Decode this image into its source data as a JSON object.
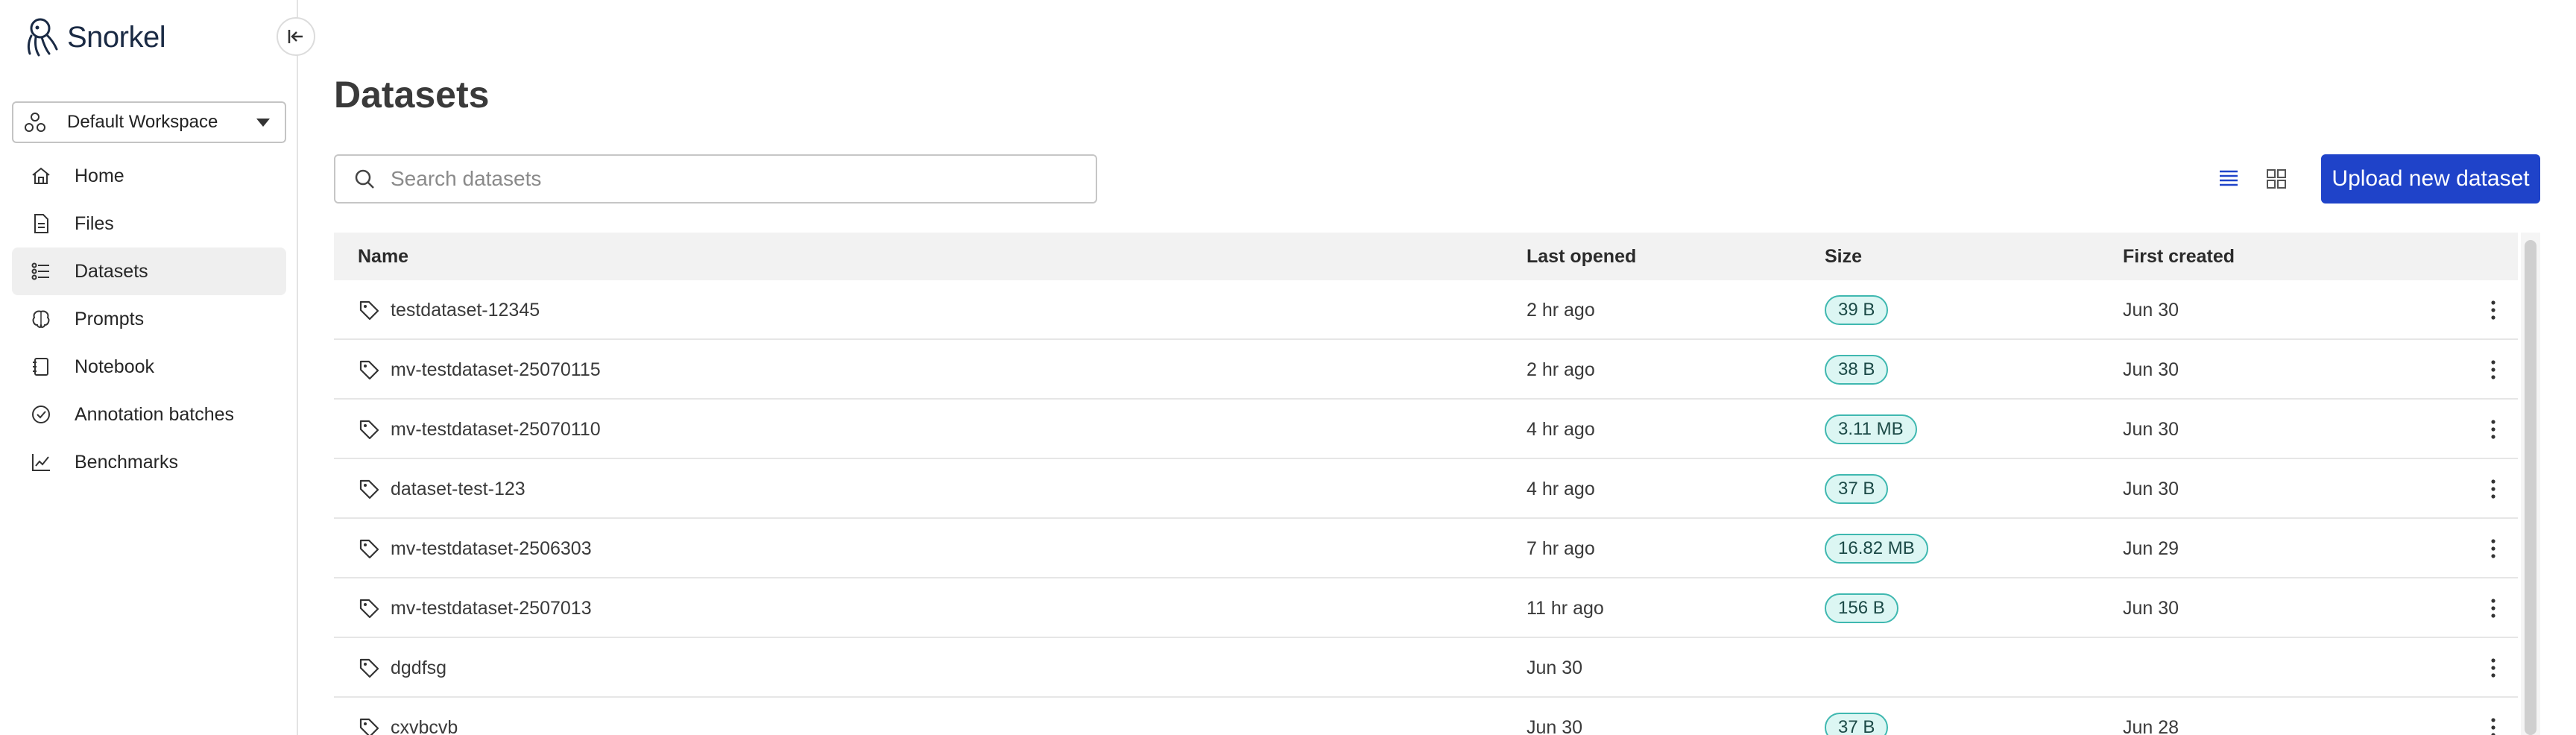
{
  "app": {
    "name": "Snorkel"
  },
  "sidebar": {
    "workspace": {
      "label": "Default Workspace"
    },
    "items": [
      {
        "label": "Home",
        "icon": "home-icon",
        "active": false
      },
      {
        "label": "Files",
        "icon": "file-icon",
        "active": false
      },
      {
        "label": "Datasets",
        "icon": "datasets-icon",
        "active": true
      },
      {
        "label": "Prompts",
        "icon": "brain-icon",
        "active": false
      },
      {
        "label": "Notebook",
        "icon": "notebook-icon",
        "active": false
      },
      {
        "label": "Annotation batches",
        "icon": "check-circle-icon",
        "active": false
      },
      {
        "label": "Benchmarks",
        "icon": "chart-icon",
        "active": false
      }
    ]
  },
  "main": {
    "title": "Datasets",
    "search": {
      "placeholder": "Search datasets",
      "value": ""
    },
    "upload_label": "Upload new dataset",
    "table": {
      "headers": {
        "name": "Name",
        "last_opened": "Last opened",
        "size": "Size",
        "first_created": "First created"
      },
      "rows": [
        {
          "name": "testdataset-12345",
          "last_opened": "2 hr ago",
          "size": "39 B",
          "first_created": "Jun 30"
        },
        {
          "name": "mv-testdataset-25070115",
          "last_opened": "2 hr ago",
          "size": "38 B",
          "first_created": "Jun 30"
        },
        {
          "name": "mv-testdataset-25070110",
          "last_opened": "4 hr ago",
          "size": "3.11 MB",
          "first_created": "Jun 30"
        },
        {
          "name": "dataset-test-123",
          "last_opened": "4 hr ago",
          "size": "37 B",
          "first_created": "Jun 30"
        },
        {
          "name": "mv-testdataset-2506303",
          "last_opened": "7 hr ago",
          "size": "16.82 MB",
          "first_created": "Jun 29"
        },
        {
          "name": "mv-testdataset-2507013",
          "last_opened": "11 hr ago",
          "size": "156 B",
          "first_created": "Jun 30"
        },
        {
          "name": "dgdfsg",
          "last_opened": "Jun 30",
          "size": "",
          "first_created": ""
        },
        {
          "name": "cxvbcvb",
          "last_opened": "Jun 30",
          "size": "37 B",
          "first_created": "Jun 28"
        }
      ]
    }
  },
  "colors": {
    "primary": "#1f43c9",
    "badge_border": "#3fb8b0",
    "badge_bg": "#dcf6f3",
    "active_nav": "#efefef",
    "brand": "#1a2a44"
  }
}
